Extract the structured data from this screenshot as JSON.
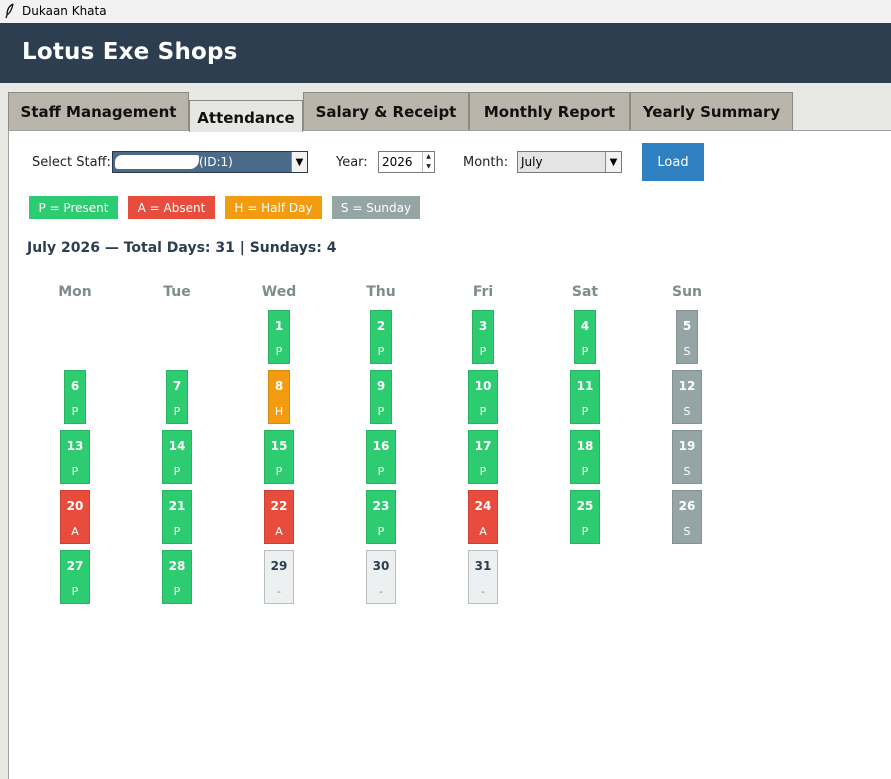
{
  "window": {
    "title": "Dukaan Khata",
    "icon": "feather-icon"
  },
  "header": {
    "shop_name": "Lotus Exe Shops"
  },
  "tabs": [
    {
      "label": "Staff Management",
      "active": false
    },
    {
      "label": "Attendance",
      "active": true
    },
    {
      "label": "Salary & Receipt",
      "active": false
    },
    {
      "label": "Monthly Report",
      "active": false
    },
    {
      "label": "Yearly Summary",
      "active": false
    }
  ],
  "controls": {
    "staff_label": "Select Staff:",
    "staff_value": "(ID:1)",
    "year_label": "Year:",
    "year_value": "2026",
    "month_label": "Month:",
    "month_value": "July",
    "load_label": "Load"
  },
  "legend": [
    {
      "label": "P = Present",
      "color": "#2ecc71"
    },
    {
      "label": "A = Absent",
      "color": "#e74c3c"
    },
    {
      "label": "H = Half Day",
      "color": "#f39c12"
    },
    {
      "label": "S = Sunday",
      "color": "#95a5a6"
    }
  ],
  "calendar": {
    "title": "July 2026 — Total Days: 31 | Sundays: 4",
    "weekdays": [
      "Mon",
      "Tue",
      "Wed",
      "Thu",
      "Fri",
      "Sat",
      "Sun"
    ],
    "status_colors": {
      "P": "#2ecc71",
      "A": "#e74c3c",
      "H": "#f39c12",
      "S": "#95a5a6",
      "-": "#ecf0f1"
    },
    "days": [
      {
        "day": "1",
        "status": "P"
      },
      {
        "day": "2",
        "status": "P"
      },
      {
        "day": "3",
        "status": "P"
      },
      {
        "day": "4",
        "status": "P"
      },
      {
        "day": "5",
        "status": "S"
      },
      {
        "day": "6",
        "status": "P"
      },
      {
        "day": "7",
        "status": "P"
      },
      {
        "day": "8",
        "status": "H"
      },
      {
        "day": "9",
        "status": "P"
      },
      {
        "day": "10",
        "status": "P"
      },
      {
        "day": "11",
        "status": "P"
      },
      {
        "day": "12",
        "status": "S"
      },
      {
        "day": "13",
        "status": "P"
      },
      {
        "day": "14",
        "status": "P"
      },
      {
        "day": "15",
        "status": "P"
      },
      {
        "day": "16",
        "status": "P"
      },
      {
        "day": "17",
        "status": "P"
      },
      {
        "day": "18",
        "status": "P"
      },
      {
        "day": "19",
        "status": "S"
      },
      {
        "day": "20",
        "status": "A"
      },
      {
        "day": "21",
        "status": "P"
      },
      {
        "day": "22",
        "status": "A"
      },
      {
        "day": "23",
        "status": "P"
      },
      {
        "day": "24",
        "status": "A"
      },
      {
        "day": "25",
        "status": "P"
      },
      {
        "day": "26",
        "status": "S"
      },
      {
        "day": "27",
        "status": "P"
      },
      {
        "day": "28",
        "status": "P"
      },
      {
        "day": "29",
        "status": "-"
      },
      {
        "day": "30",
        "status": "-"
      },
      {
        "day": "31",
        "status": "-"
      }
    ]
  }
}
